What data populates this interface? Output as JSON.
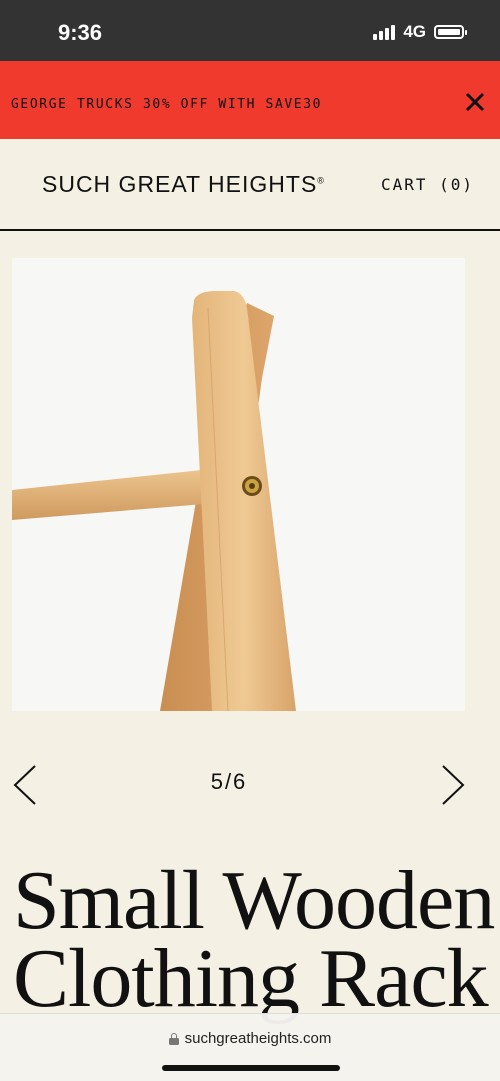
{
  "status_bar": {
    "time": "9:36",
    "network": "4G",
    "icons": [
      "signal-icon",
      "battery-icon"
    ]
  },
  "promo": {
    "text": "GEORGE TRUCKS 30% OFF WITH SAVE30",
    "close_icon": "close-icon"
  },
  "header": {
    "logo": "SUCH GREAT HEIGHTS",
    "logo_mark": "®",
    "cart": "CART (0)"
  },
  "gallery": {
    "counter": "5/6",
    "prev_icon": "chevron-left-icon",
    "next_icon": "chevron-right-icon"
  },
  "product": {
    "title_line1": "Small Wooden",
    "title_line2": "Clothing Rack"
  },
  "browser": {
    "url": "suchgreatheights.com",
    "lock_icon": "lock-icon"
  },
  "colors": {
    "banner": "#f03a2e",
    "page_background": "#f4f0e3",
    "status_bar": "#333333",
    "text": "#111111"
  }
}
